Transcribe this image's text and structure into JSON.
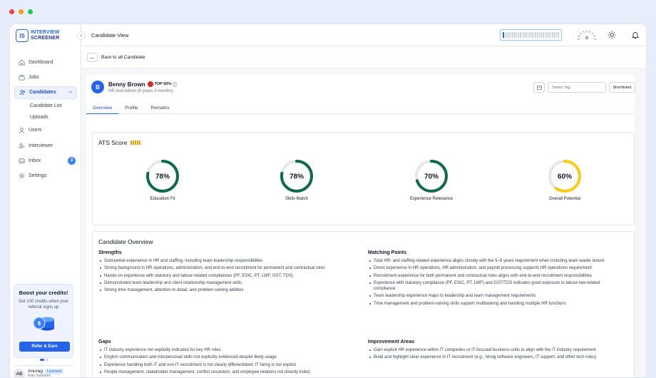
{
  "window_dots": [
    "#ef4444",
    "#f59e0b",
    "#22c55e"
  ],
  "brand": {
    "logo_mark": "IS",
    "line1": "INTERVIEW",
    "line2": "SCREENER"
  },
  "sidebar": {
    "items": [
      {
        "label": "Dashboard",
        "icon": "home-icon"
      },
      {
        "label": "Jobs",
        "icon": "briefcase-icon"
      },
      {
        "label": "Candidates",
        "icon": "users-icon",
        "active": true
      },
      {
        "label": "Users",
        "icon": "user-icon"
      },
      {
        "label": "Interviewer",
        "icon": "user-check-icon"
      },
      {
        "label": "Inbox",
        "icon": "inbox-icon",
        "badge": "3"
      },
      {
        "label": "Settings",
        "icon": "gear-icon"
      }
    ],
    "candidate_sub": [
      "Candidate List",
      "Uploads"
    ],
    "promo": {
      "title": "Boost your credits!",
      "text": "Get 100 credits when your referral signs up",
      "button": "Refer & Earn"
    },
    "user": {
      "initials": "AB",
      "name": "Anurag",
      "license": "Licensed",
      "company": "Klao Solutions"
    }
  },
  "topbar": {
    "title": "Candidate View"
  },
  "back_label": "Back to all Candidate",
  "candidate": {
    "initial": "B",
    "name": "Benny Brown",
    "badge": "TOP 50%",
    "role": "HR And Admin (8 years 3 months)",
    "tag_placeholder": "Select Tag",
    "status": "Shortlisted"
  },
  "tabs": [
    "Overview",
    "Profile",
    "Remarks"
  ],
  "ats": {
    "title": "ATS Score",
    "scores": [
      {
        "label": "Education Fit",
        "value": 78,
        "display": "78%",
        "color": "#0f6b4a"
      },
      {
        "label": "Skills Match",
        "value": 78,
        "display": "78%",
        "color": "#0f6b4a"
      },
      {
        "label": "Experience Relevance",
        "value": 70,
        "display": "70%",
        "color": "#0f6b4a"
      },
      {
        "label": "Overall Potential",
        "value": 60,
        "display": "60%",
        "color": "#facc15"
      }
    ]
  },
  "overview": {
    "title": "Candidate Overview",
    "strengths": {
      "title": "Strengths",
      "items": [
        "Substantial experience in HR and staffing, including team leadership responsibilities",
        "Strong background in HR operations, administration, and end-to-end recruitment for permanent and contractual roles",
        "Hands-on experience with statutory and labour-related compliances (PF, ESIC, PT, LWF, GST, TDS)",
        "Demonstrated team leadership and client relationship management skills",
        "Strong time management, attention to detail, and problem-solving abilities"
      ]
    },
    "matching": {
      "title": "Matching Points",
      "items": [
        "Total HR- and staffing-related experience aligns closely with the 5–6 years requirement when including team leader tenure",
        "Direct experience in HR operations, HR administration, and payroll processing supports HR operations requirement",
        "Recruitment experience for both permanent and contractual roles aligns with end-to-end recruitment responsibilities",
        "Experience with statutory compliance (PF, ESIC, PT, LWF) and GST/TDS indicates good exposure to labour-law-related compliance",
        "Team leadership experience maps to leadership and team management requirements",
        "Time management and problem-solving skills support multitasking and handling multiple HR functions"
      ]
    },
    "gaps": {
      "title": "Gaps",
      "items": [
        "IT industry experience not explicitly indicated for key HR roles",
        "English communication and interpersonal skills not explicitly evidenced despite likely usage",
        "Experience handling both IT and non-IT recruitment is not clearly differentiated; IT hiring is not explicit",
        "People management, stakeholder management, conflict resolution, and employee relations not directly listed,"
      ]
    },
    "improvement": {
      "title": "Improvement Areas",
      "items": [
        "Gain explicit HR experience within IT companies or IT-focused business units to align with the IT industry requirement",
        "Build and highlight clear experience in IT recruitment (e.g., hiring software engineers, IT support, and other tech roles)"
      ]
    }
  }
}
